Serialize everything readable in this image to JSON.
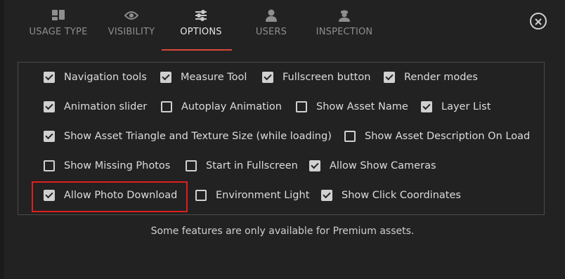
{
  "tabs": [
    {
      "label": "USAGE TYPE",
      "icon": "usage-type-icon"
    },
    {
      "label": "VISIBILITY",
      "icon": "eye-icon"
    },
    {
      "label": "OPTIONS",
      "icon": "sliders-icon",
      "active": true
    },
    {
      "label": "USERS",
      "icon": "user-icon"
    },
    {
      "label": "INSPECTION",
      "icon": "inspector-icon"
    }
  ],
  "close_icon": "close-icon",
  "options": {
    "navigation_tools": {
      "label": "Navigation tools",
      "checked": true
    },
    "measure_tool": {
      "label": "Measure Tool",
      "checked": true
    },
    "fullscreen_button": {
      "label": "Fullscreen button",
      "checked": true
    },
    "render_modes": {
      "label": "Render modes",
      "checked": true
    },
    "animation_slider": {
      "label": "Animation slider",
      "checked": true
    },
    "autoplay_animation": {
      "label": "Autoplay Animation",
      "checked": false
    },
    "show_asset_name": {
      "label": "Show Asset Name",
      "checked": false
    },
    "layer_list": {
      "label": "Layer List",
      "checked": true
    },
    "show_asset_triangle": {
      "label": "Show Asset Triangle and Texture Size (while loading)",
      "checked": true
    },
    "show_asset_description": {
      "label": "Show Asset Description On Load",
      "checked": false
    },
    "show_missing_photos": {
      "label": "Show Missing Photos",
      "checked": false
    },
    "start_in_fullscreen": {
      "label": "Start in Fullscreen",
      "checked": false
    },
    "allow_show_cameras": {
      "label": "Allow Show Cameras",
      "checked": true
    },
    "allow_photo_download": {
      "label": "Allow Photo Download",
      "checked": true
    },
    "environment_light": {
      "label": "Environment Light",
      "checked": false
    },
    "show_click_coordinates": {
      "label": "Show Click Coordinates",
      "checked": true
    }
  },
  "footnote": "Some features are only available for Premium assets.",
  "colors": {
    "accent_underline": "#d9463a",
    "highlight_box": "#e01e1e"
  }
}
